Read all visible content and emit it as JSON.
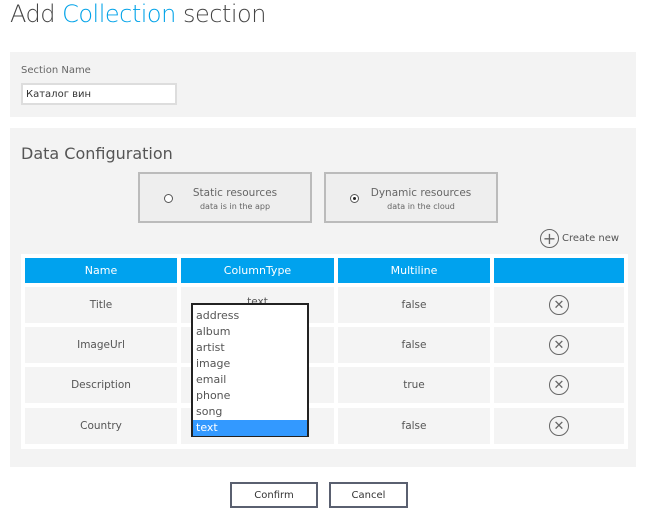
{
  "header": {
    "title_prefix": "Add",
    "title_accent": "Collection",
    "title_suffix": "section"
  },
  "section_name": {
    "label": "Section Name",
    "value": "Каталог вин"
  },
  "data_config": {
    "title": "Data Configuration",
    "options": [
      {
        "title": "Static resources",
        "subtitle": "data is in the app",
        "selected": false
      },
      {
        "title": "Dynamic resources",
        "subtitle": "data in the cloud",
        "selected": true
      }
    ],
    "create_new": "Create new"
  },
  "table": {
    "headers": [
      "Name",
      "ColumnType",
      "Multiline",
      ""
    ],
    "rows": [
      {
        "name": "Title",
        "type": "text",
        "multiline": "false"
      },
      {
        "name": "ImageUrl",
        "type": "",
        "multiline": "false"
      },
      {
        "name": "Description",
        "type": "",
        "multiline": "true"
      },
      {
        "name": "Country",
        "type": "",
        "multiline": "false"
      }
    ]
  },
  "dropdown": {
    "options": [
      "address",
      "album",
      "artist",
      "image",
      "email",
      "phone",
      "song",
      "text"
    ],
    "selected": "text"
  },
  "footer": {
    "confirm": "Confirm",
    "cancel": "Cancel"
  },
  "colors": {
    "accent": "#00a2e8",
    "header": "#00a2ee",
    "selection": "#3399ff"
  }
}
